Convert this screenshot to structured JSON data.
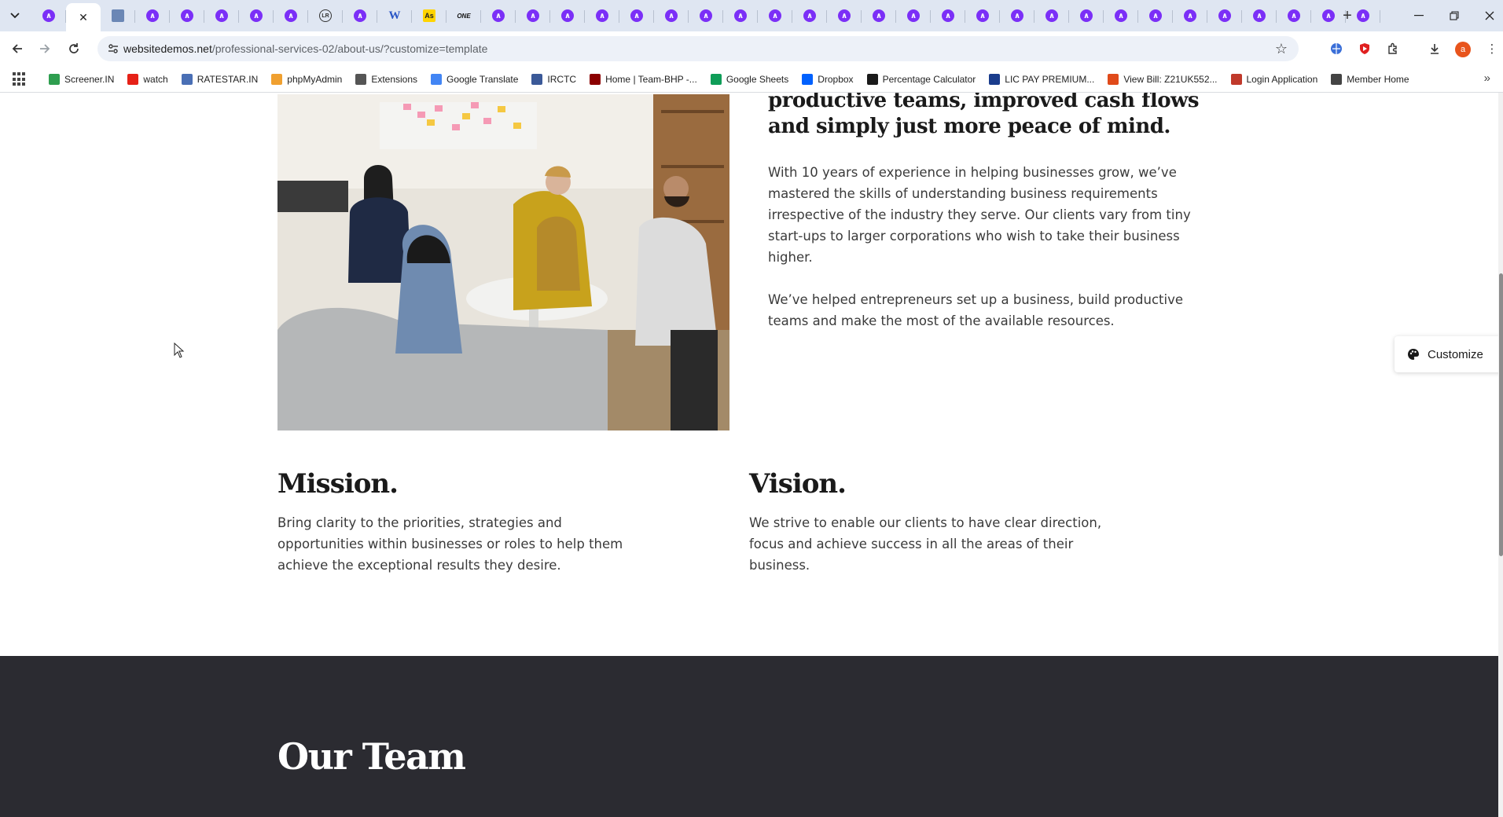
{
  "browser": {
    "tabs": [
      {
        "icon": "astra-icon",
        "active": false
      },
      {
        "icon": "astra-icon",
        "active": true
      },
      {
        "icon": "book-icon",
        "active": false
      },
      {
        "icon": "astra-icon",
        "active": false
      },
      {
        "icon": "astra-icon",
        "active": false
      },
      {
        "icon": "astra-icon",
        "active": false
      },
      {
        "icon": "astra-icon",
        "active": false
      },
      {
        "icon": "astra-icon",
        "active": false
      },
      {
        "icon": "lr-icon",
        "active": false
      },
      {
        "icon": "astra-icon",
        "active": false
      },
      {
        "icon": "wordpress-icon",
        "active": false
      },
      {
        "icon": "as-icon",
        "active": false
      },
      {
        "icon": "brand-icon",
        "active": false
      },
      {
        "icon": "astra-icon",
        "active": false
      },
      {
        "icon": "astra-icon",
        "active": false
      },
      {
        "icon": "astra-icon",
        "active": false
      },
      {
        "icon": "astra-icon",
        "active": false
      },
      {
        "icon": "astra-icon",
        "active": false
      },
      {
        "icon": "astra-icon",
        "active": false
      },
      {
        "icon": "astra-icon",
        "active": false
      },
      {
        "icon": "astra-icon",
        "active": false
      },
      {
        "icon": "astra-icon",
        "active": false
      },
      {
        "icon": "astra-icon",
        "active": false
      },
      {
        "icon": "astra-icon",
        "active": false
      },
      {
        "icon": "astra-icon",
        "active": false
      },
      {
        "icon": "astra-icon",
        "active": false
      },
      {
        "icon": "astra-icon",
        "active": false
      },
      {
        "icon": "astra-icon",
        "active": false
      },
      {
        "icon": "astra-icon",
        "active": false
      },
      {
        "icon": "astra-icon",
        "active": false
      },
      {
        "icon": "astra-icon",
        "active": false
      },
      {
        "icon": "astra-icon",
        "active": false
      },
      {
        "icon": "astra-icon",
        "active": false
      },
      {
        "icon": "astra-icon",
        "active": false
      },
      {
        "icon": "astra-icon",
        "active": false
      },
      {
        "icon": "astra-icon",
        "active": false
      },
      {
        "icon": "astra-icon",
        "active": false
      },
      {
        "icon": "astra-icon",
        "active": false
      },
      {
        "icon": "astra-icon",
        "active": false
      }
    ],
    "url_host": "websitedemos.net",
    "url_path": "/professional-services-02/about-us/?customize=template",
    "profile_initial": "a",
    "bookmarks": [
      {
        "label": "Screener.IN",
        "color": "#2e9e4f"
      },
      {
        "label": "watch",
        "color": "#e62117"
      },
      {
        "label": "RATESTAR.IN",
        "color": "#4a6fb5"
      },
      {
        "label": "phpMyAdmin",
        "color": "#f0a030"
      },
      {
        "label": "Extensions",
        "color": "#555555"
      },
      {
        "label": "Google Translate",
        "color": "#4285f4"
      },
      {
        "label": "IRCTC",
        "color": "#3b5998"
      },
      {
        "label": "Home | Team-BHP -...",
        "color": "#8b0000"
      },
      {
        "label": "Google Sheets",
        "color": "#0f9d58"
      },
      {
        "label": "Dropbox",
        "color": "#0061fe"
      },
      {
        "label": "Percentage Calculator",
        "color": "#1a1a1a"
      },
      {
        "label": "LIC PAY PREMIUM...",
        "color": "#1a3c8c"
      },
      {
        "label": "View Bill: Z21UK552...",
        "color": "#e04a1a"
      },
      {
        "label": "Login Application",
        "color": "#c0392b"
      },
      {
        "label": "Member Home",
        "color": "#444444"
      }
    ]
  },
  "page": {
    "headline": "productive teams, improved cash flows and simply just more peace of mind.",
    "intro_p1": "With 10 years of experience in helping businesses grow, we’ve mastered the skills of understanding business requirements irrespective of the industry they serve. Our clients vary from tiny start-ups to larger corporations who wish to take their business higher.",
    "intro_p2": "We’ve helped entrepreneurs set up a business, build productive teams and make the most of the available resources.",
    "mission_title": "Mission.",
    "mission_text": "Bring clarity to the priorities, strategies and opportunities within businesses or roles to help them achieve the exceptional results they desire.",
    "vision_title": "Vision.",
    "vision_text": "We strive to enable our clients to have clear direction, focus and achieve success in all the areas of their business.",
    "team_title": "Our Team",
    "customize_label": "Customize"
  }
}
